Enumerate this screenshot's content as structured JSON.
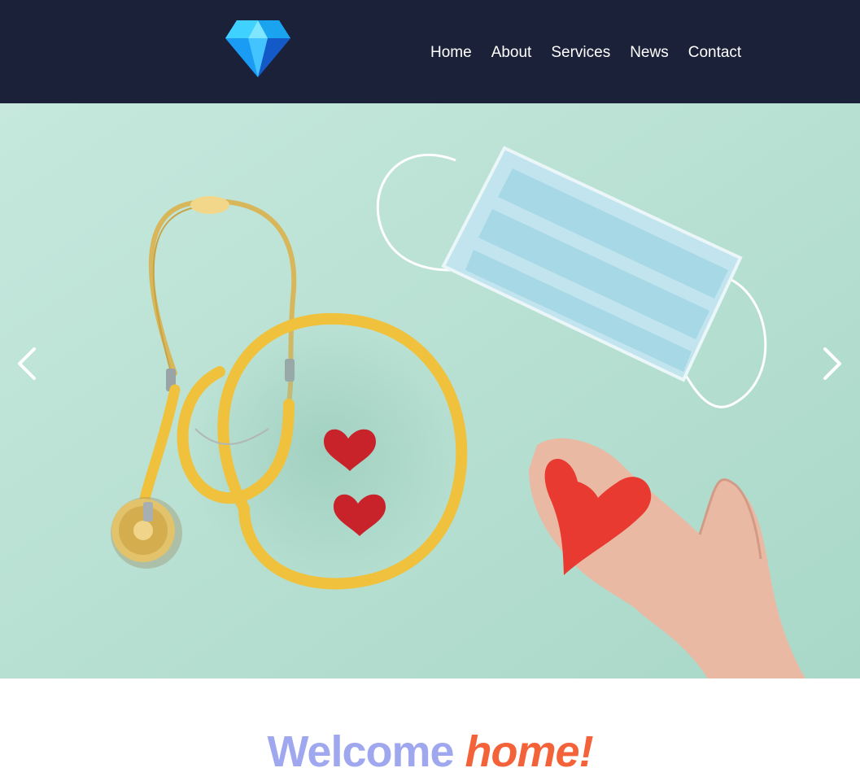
{
  "header": {
    "logo_icon": "diamond-icon",
    "background_color": "#1b2139"
  },
  "nav": {
    "items": [
      {
        "label": "Home"
      },
      {
        "label": "About"
      },
      {
        "label": "Services"
      },
      {
        "label": "News"
      },
      {
        "label": "Contact"
      }
    ]
  },
  "hero": {
    "prev_icon": "chevron-left-icon",
    "next_icon": "chevron-right-icon",
    "background_color": "#bfe3d6"
  },
  "welcome": {
    "main": "Welcome",
    "accent": "home!",
    "main_color": "#9fa7ee",
    "accent_color": "#f4623a"
  }
}
